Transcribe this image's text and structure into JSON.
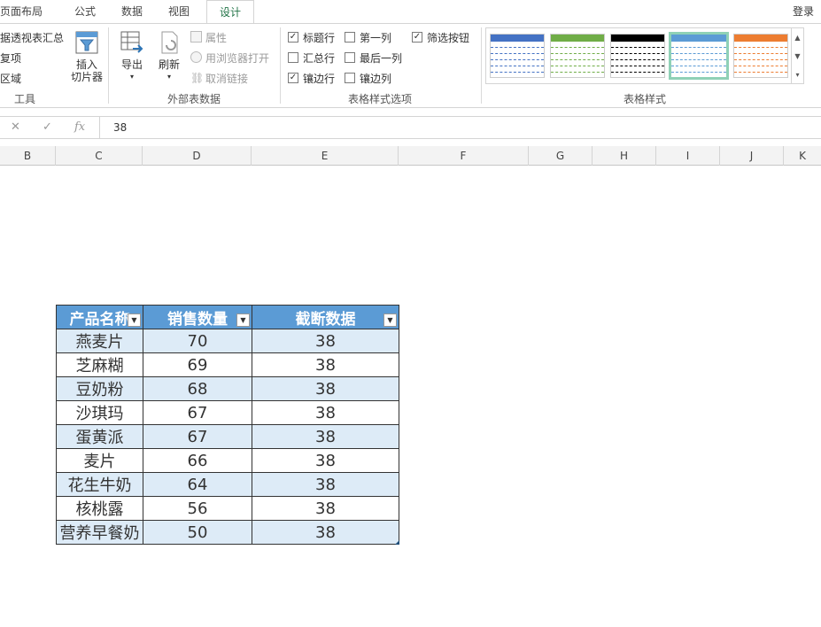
{
  "tabs": [
    {
      "label": "页面布局",
      "active": false
    },
    {
      "label": "公式",
      "active": false
    },
    {
      "label": "数据",
      "active": false
    },
    {
      "label": "视图",
      "active": false
    },
    {
      "label": "设计",
      "active": true
    }
  ],
  "login_label": "登录",
  "ribbon": {
    "tools": {
      "item1": "据透视表汇总",
      "item2": "复项",
      "item3": "区域",
      "insert_slicer_line1": "插入",
      "insert_slicer_line2": "切片器",
      "label": "工具"
    },
    "external": {
      "export": "导出",
      "refresh": "刷新",
      "properties": "属性",
      "open_browser": "用浏览器打开",
      "unlink": "取消链接",
      "label": "外部表数据"
    },
    "style_options": {
      "header_row": "标题行",
      "total_row": "汇总行",
      "banded_rows": "镶边行",
      "first_column": "第一列",
      "last_column": "最后一列",
      "banded_columns": "镶边列",
      "filter_button": "筛选按钮",
      "label": "表格样式选项",
      "checked": {
        "header_row": true,
        "total_row": false,
        "banded_rows": true,
        "first_column": false,
        "last_column": false,
        "banded_columns": false,
        "filter_button": true
      }
    },
    "table_styles": {
      "label": "表格样式",
      "swatch_colors": [
        "#4472c4",
        "#70ad47",
        "#000000",
        "#5b9bd5",
        "#ed7d31"
      ],
      "selected_index": 3
    }
  },
  "formula_bar": {
    "cancel_icon": "✕",
    "enter_icon": "✓",
    "fx_icon": "fx",
    "value": "38"
  },
  "columns": [
    "B",
    "C",
    "D",
    "E",
    "F",
    "G",
    "H",
    "I",
    "J",
    "K"
  ],
  "table": {
    "headers": [
      "产品名称",
      "销售数量",
      "截断数据"
    ],
    "rows": [
      [
        "燕麦片",
        "70",
        "38"
      ],
      [
        "芝麻糊",
        "69",
        "38"
      ],
      [
        "豆奶粉",
        "68",
        "38"
      ],
      [
        "沙琪玛",
        "67",
        "38"
      ],
      [
        "蛋黄派",
        "67",
        "38"
      ],
      [
        "麦片",
        "66",
        "38"
      ],
      [
        "花生牛奶",
        "64",
        "38"
      ],
      [
        "核桃露",
        "56",
        "38"
      ],
      [
        "营养早餐奶",
        "50",
        "38"
      ]
    ]
  }
}
